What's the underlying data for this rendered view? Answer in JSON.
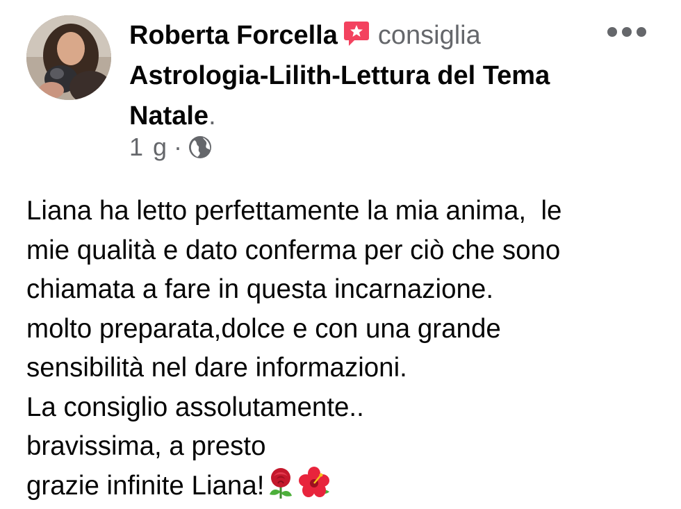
{
  "post": {
    "author": "Roberta Forcella",
    "action": "consiglia",
    "page": "Astrologia-Lilith-Lettura del Tema Natale",
    "period": ".",
    "time": "1 g",
    "separator": "·",
    "audience_icon": "globe-icon",
    "recommend_icon": "recommend-flag-icon",
    "more_icon": "more-dots-icon",
    "body_lines": [
      "Liana ha letto perfettamente la mia anima,  le",
      "mie qualità e dato conferma per ciò che sono",
      "chiamata a fare in questa incarnazione.",
      "molto preparata,dolce e con una grande",
      "sensibilità nel dare informazioni.",
      "La consiglio assolutamente..",
      "bravissima, a presto",
      "grazie infinite Liana!"
    ],
    "trailing_emojis": [
      "rose-emoji",
      "hibiscus-emoji"
    ]
  },
  "colors": {
    "primary_text": "#050505",
    "secondary_text": "#65676b",
    "recommend_accent": "#f3425f"
  }
}
